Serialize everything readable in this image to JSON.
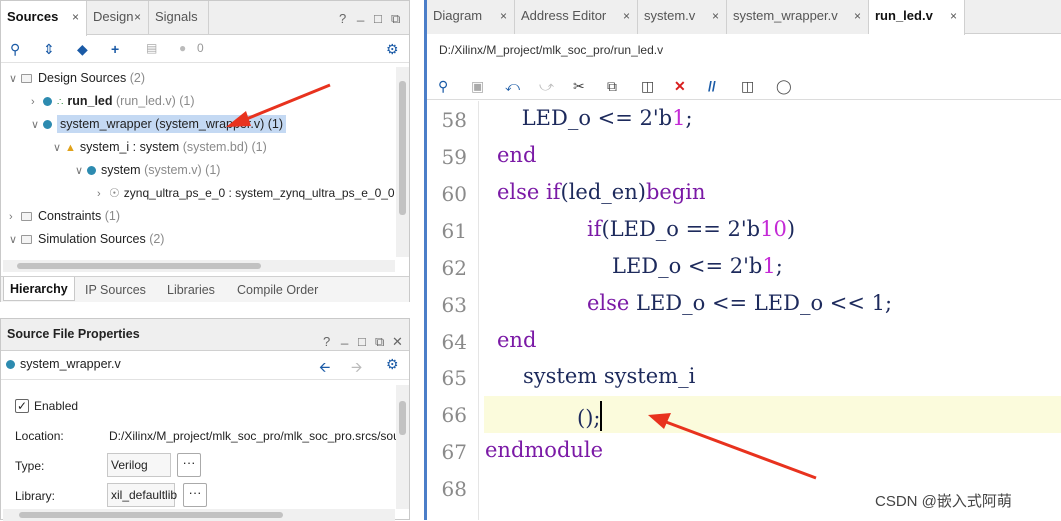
{
  "sources": {
    "tabs": [
      {
        "label": "Sources",
        "close": "×"
      },
      {
        "label": "Design",
        "close": "×"
      },
      {
        "label": "Signals",
        "close": ""
      }
    ],
    "window_controls": [
      "?",
      "_",
      "□",
      "⧉"
    ],
    "toolbar_count": "0",
    "tree": {
      "design_sources": {
        "label": "Design Sources",
        "count": "(2)"
      },
      "run_led": {
        "name": "run_led",
        "file": "(run_led.v) (1)"
      },
      "system_wrapper": {
        "text": "system_wrapper (system_wrapper.v) (1)"
      },
      "system_i": {
        "name": "system_i : system",
        "file": "(system.bd) (1)"
      },
      "system": {
        "name": "system",
        "file": "(system.v) (1)"
      },
      "zynq": {
        "text": "zynq_ultra_ps_e_0 : system_zynq_ultra_ps_e_0_0"
      },
      "constraints": {
        "label": "Constraints",
        "count": "(1)"
      },
      "simulation": {
        "label": "Simulation Sources",
        "count": "(2)"
      }
    },
    "subtabs": [
      "Hierarchy",
      "IP Sources",
      "Libraries",
      "Compile Order"
    ]
  },
  "props": {
    "title": "Source File Properties",
    "window_controls": [
      "?",
      "_",
      "□",
      "⧉",
      "✕"
    ],
    "file": "system_wrapper.v",
    "enabled_label": "Enabled",
    "enabled": true,
    "location_label": "Location:",
    "location_value": "D:/Xilinx/M_project/mlk_soc_pro/mlk_soc_pro.srcs/sou",
    "type_label": "Type:",
    "type_value": "Verilog",
    "library_label": "Library:",
    "library_value": "xil_defaultlib",
    "more_btn": "···"
  },
  "editor": {
    "tabs": [
      {
        "label": "Diagram",
        "close": "×"
      },
      {
        "label": "Address Editor",
        "close": "×"
      },
      {
        "label": "system.v",
        "close": "×"
      },
      {
        "label": "system_wrapper.v",
        "close": "×"
      },
      {
        "label": "run_led.v",
        "close": "×"
      }
    ],
    "path": "D:/Xilinx/M_project/mlk_soc_pro/run_led.v",
    "line_numbers": [
      "58",
      "59",
      "60",
      "61",
      "62",
      "63",
      "64",
      "65",
      "66",
      "67",
      "68"
    ],
    "code": {
      "l58a": "    LED_o <= 2'b",
      "l58n": "1",
      "l58b": ";",
      "l59": "end",
      "l60a": "else if",
      "l60b": "(led_en)",
      "l60c": "begin",
      "l61a": "if",
      "l61b": "(LED_o == 2'b",
      "l61n": "10",
      "l61c": ")",
      "l62a": "LED_o <= 2'b",
      "l62n": "1",
      "l62b": ";",
      "l63a": "else",
      "l63b": " LED_o <= LED_o << 1;",
      "l64": "end",
      "l65": "system system_i",
      "l66": "();",
      "l67": "endmodule"
    }
  },
  "watermark": "CSDN @嵌入式阿萌",
  "colors": {
    "accent": "#4b7ec8",
    "keyword": "#7b1aa6",
    "number": "#c42ad6",
    "arrow": "#e8321e",
    "selection": "#c4d9f3"
  }
}
